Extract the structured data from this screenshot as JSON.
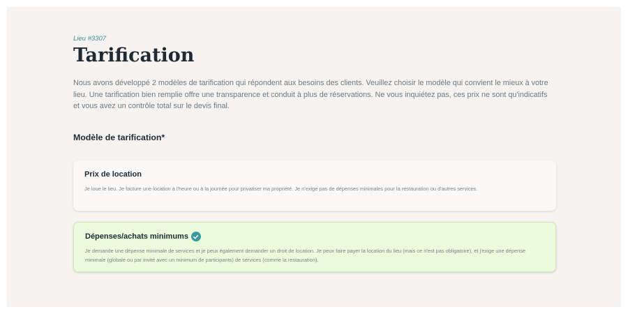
{
  "header": {
    "venue_id": "Lieu #3307",
    "title": "Tarification",
    "intro": "Nous avons développé 2 modèles de tarification qui répondent aux besoins des clients. Veuillez choisir le modèle qui convient le mieux à votre lieu. Une tarification bien remplie offre une transparence et conduit à plus de réservations. Ne vous inquiétez pas, ces prix ne sont qu'indicatifs et vous avez un contrôle total sur le devis final."
  },
  "pricing_model": {
    "label": "Modèle de tarification*",
    "options": [
      {
        "title": "Prix de location",
        "description": "Je loue le lieu. Je facture une location à l'heure ou à la journée pour privatiser ma propriété. Je n'exige pas de dépenses minimales pour la restauration ou d'autres services.",
        "selected": false
      },
      {
        "title": "Dépenses/achats minimums",
        "description": "Je demande une dépense minimale de services et je peux également demander un droit de location. Je peux faire payer la location du lieu (mais ce n'est pas obligatoire), et j'exige une dépense minimale (globale ou par invité avec un minimum de participants) de services (comme la restauration).",
        "selected": true,
        "icon": "check-circle-icon"
      }
    ]
  },
  "colors": {
    "selected_bg": "#eafcdc",
    "accent": "#3d9aa1",
    "title": "#1f2a35"
  }
}
